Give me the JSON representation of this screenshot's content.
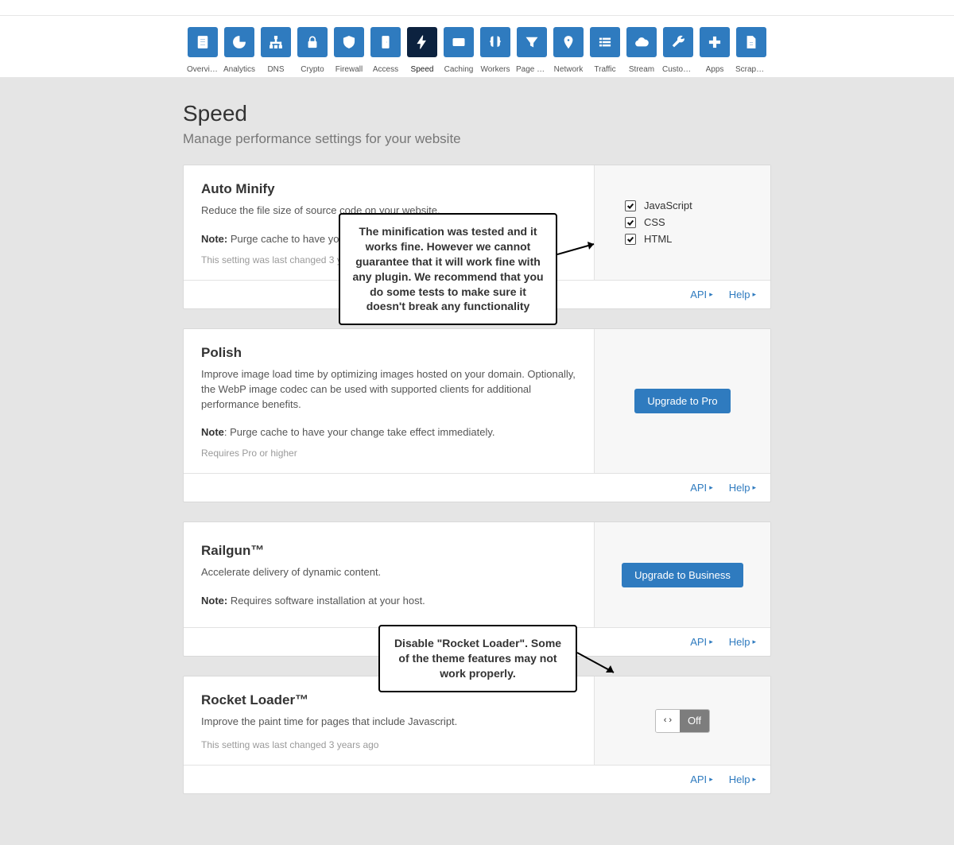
{
  "nav": {
    "items": [
      {
        "id": "overview",
        "label": "Overview",
        "icon": "file"
      },
      {
        "id": "analytics",
        "label": "Analytics",
        "icon": "pie"
      },
      {
        "id": "dns",
        "label": "DNS",
        "icon": "sitemap"
      },
      {
        "id": "crypto",
        "label": "Crypto",
        "icon": "lock"
      },
      {
        "id": "firewall",
        "label": "Firewall",
        "icon": "shield"
      },
      {
        "id": "access",
        "label": "Access",
        "icon": "door"
      },
      {
        "id": "speed",
        "label": "Speed",
        "icon": "bolt",
        "active": true
      },
      {
        "id": "caching",
        "label": "Caching",
        "icon": "drawer"
      },
      {
        "id": "workers",
        "label": "Workers",
        "icon": "braces"
      },
      {
        "id": "pagerules",
        "label": "Page Rules",
        "icon": "funnel"
      },
      {
        "id": "network",
        "label": "Network",
        "icon": "pin"
      },
      {
        "id": "traffic",
        "label": "Traffic",
        "icon": "list"
      },
      {
        "id": "stream",
        "label": "Stream",
        "icon": "cloud"
      },
      {
        "id": "customp",
        "label": "Custom P...",
        "icon": "wrench"
      },
      {
        "id": "apps",
        "label": "Apps",
        "icon": "plus"
      },
      {
        "id": "scrape",
        "label": "Scrape Shi...",
        "icon": "doc"
      }
    ]
  },
  "page": {
    "title": "Speed",
    "subtitle": "Manage performance settings for your website"
  },
  "footer": {
    "api": "API",
    "help": "Help"
  },
  "cards": {
    "minify": {
      "title": "Auto Minify",
      "desc": "Reduce the file size of source code on your website.",
      "note_label": "Note:",
      "note_text": " Purge cache to have your ",
      "meta": "This setting was last changed 3 years",
      "checks": [
        {
          "label": "JavaScript",
          "checked": true
        },
        {
          "label": "CSS",
          "checked": true
        },
        {
          "label": "HTML",
          "checked": true
        }
      ]
    },
    "polish": {
      "title": "Polish",
      "desc": "Improve image load time by optimizing images hosted on your domain. Optionally, the WebP image codec can be used with supported clients for additional performance benefits.",
      "note_label": "Note",
      "note_text": ": Purge cache to have your change take effect immediately.",
      "meta": "Requires Pro or higher",
      "button": "Upgrade to Pro"
    },
    "railgun": {
      "title": "Railgun™",
      "desc": "Accelerate delivery of dynamic content.",
      "note_label": "Note:",
      "note_text": " Requires software installation at your host.",
      "button": "Upgrade to Business"
    },
    "rocket": {
      "title": "Rocket Loader™",
      "desc": "Improve the paint time for pages that include Javascript.",
      "meta": "This setting was last changed 3 years ago",
      "toggle_icon": "‹›",
      "toggle_label": "Off"
    }
  },
  "callouts": {
    "minify": "The minification was tested and it works fine. However we cannot guarantee that it will work fine with any plugin. We recommend that you do some tests to make sure it doesn't break any functionality",
    "rocket": "Disable \"Rocket Loader\". Some of the theme features may not work properly."
  }
}
